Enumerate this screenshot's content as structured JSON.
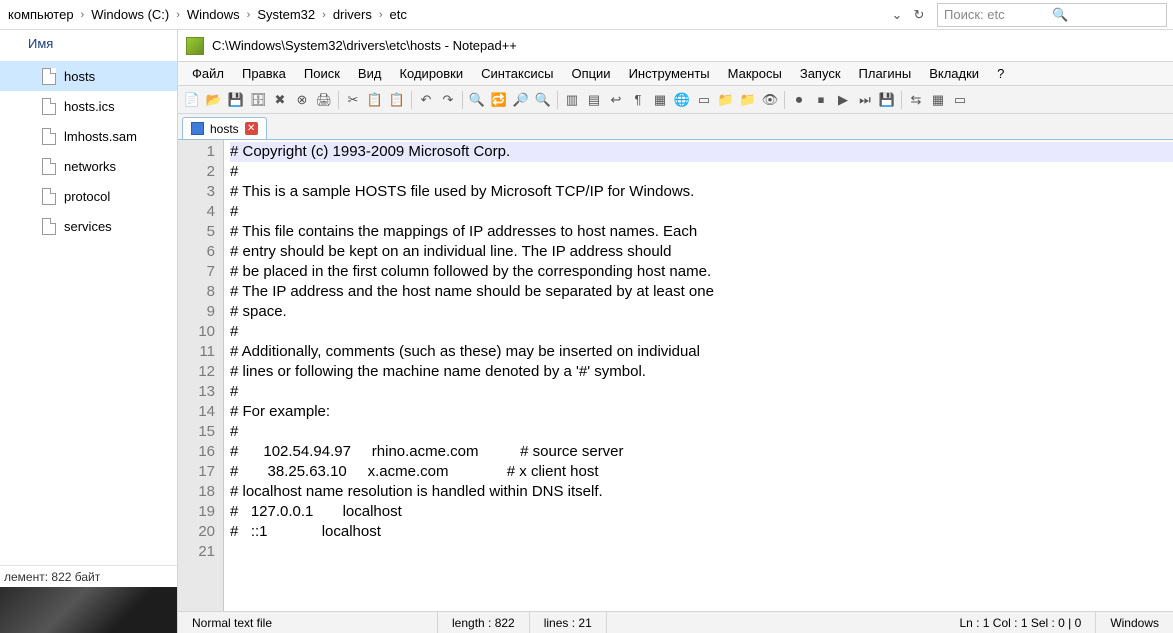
{
  "breadcrumbs": [
    "компьютер",
    "Windows (C:)",
    "Windows",
    "System32",
    "drivers",
    "etc"
  ],
  "search": {
    "placeholder": "Поиск: etc"
  },
  "explorer": {
    "column_header": "Имя",
    "files": [
      "hosts",
      "hosts.ics",
      "lmhosts.sam",
      "networks",
      "protocol",
      "services"
    ],
    "selected_index": 0,
    "status": "лемент: 822 байт"
  },
  "notepad": {
    "title": "C:\\Windows\\System32\\drivers\\etc\\hosts - Notepad++",
    "menu": [
      "Файл",
      "Правка",
      "Поиск",
      "Вид",
      "Кодировки",
      "Синтаксисы",
      "Опции",
      "Инструменты",
      "Макросы",
      "Запуск",
      "Плагины",
      "Вкладки",
      "?"
    ],
    "tab": {
      "label": "hosts"
    },
    "lines": [
      "# Copyright (c) 1993-2009 Microsoft Corp.",
      "#",
      "# This is a sample HOSTS file used by Microsoft TCP/IP for Windows.",
      "#",
      "# This file contains the mappings of IP addresses to host names. Each",
      "# entry should be kept on an individual line. The IP address should",
      "# be placed in the first column followed by the corresponding host name.",
      "# The IP address and the host name should be separated by at least one",
      "# space.",
      "#",
      "# Additionally, comments (such as these) may be inserted on individual",
      "# lines or following the machine name denoted by a '#' symbol.",
      "#",
      "# For example:",
      "#",
      "#      102.54.94.97     rhino.acme.com          # source server",
      "#       38.25.63.10     x.acme.com              # x client host",
      "# localhost name resolution is handled within DNS itself.",
      "#   127.0.0.1       localhost",
      "#   ::1             localhost",
      ""
    ],
    "status": {
      "filetype": "Normal text file",
      "length": "length : 822",
      "lines": "lines : 21",
      "pos": "Ln : 1   Col : 1   Sel : 0 | 0",
      "os": "Windows"
    }
  }
}
